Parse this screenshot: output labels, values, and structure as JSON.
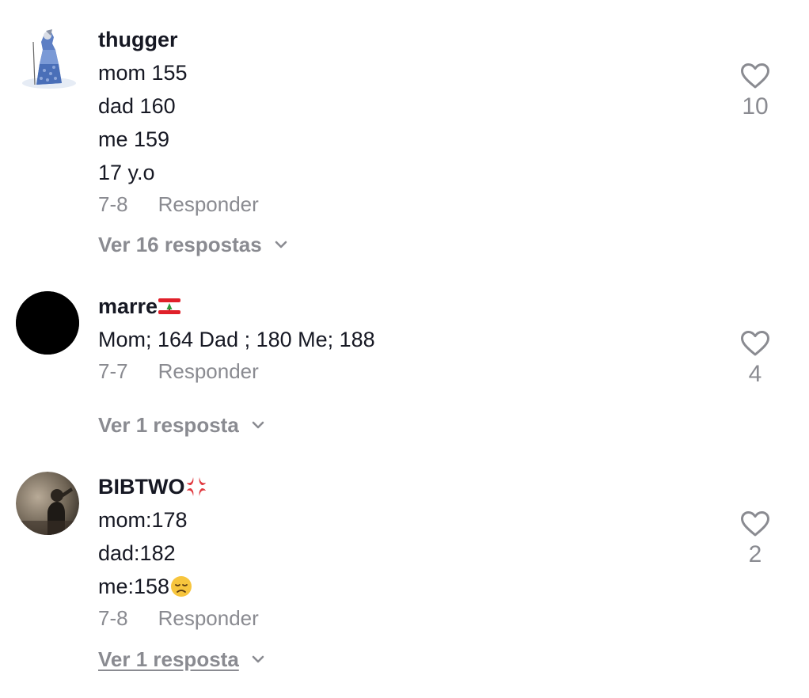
{
  "comments": [
    {
      "username": "thugger",
      "lines": [
        "mom 155",
        "dad 160",
        "me 159",
        "17 y.o"
      ],
      "date": "7-8",
      "reply_label": "Responder",
      "likes": "10",
      "view_replies": "Ver 16 respostas",
      "avatar_icon": "figure-in-blue-dress-avatar"
    },
    {
      "username": "marre",
      "username_emoji": "lebanon-flag-icon",
      "lines": [
        "Mom; 164 Dad ; 180 Me; 188"
      ],
      "date": "7-7",
      "reply_label": "Responder",
      "likes": "4",
      "view_replies": "Ver 1 resposta",
      "avatar_icon": "black-circle-avatar"
    },
    {
      "username": "BIBTWO",
      "username_emoji": "anger-symbol-icon",
      "lines": [
        "mom:178",
        "dad:182",
        "me:158"
      ],
      "line_emoji": "disappointed-face-icon",
      "date": "7-8",
      "reply_label": "Responder",
      "likes": "2",
      "view_replies": "Ver 1 resposta",
      "avatar_icon": "dark-photo-avatar"
    }
  ],
  "colors": {
    "primary_text": "#161823",
    "secondary_text": "#8a8b91"
  }
}
